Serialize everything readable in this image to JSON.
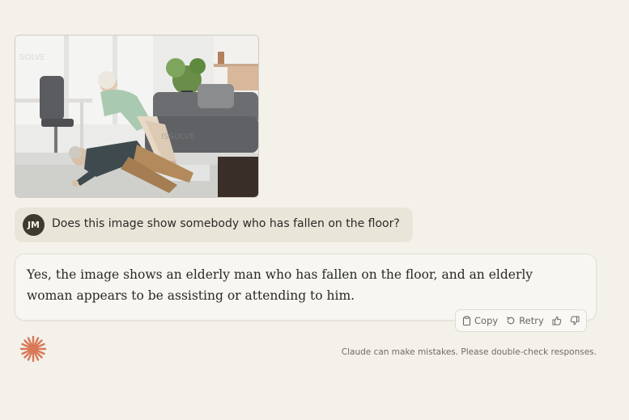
{
  "conversation": {
    "attached_image": {
      "alt": "Elderly woman helping elderly man who has fallen on the floor of a living room"
    },
    "user_message": {
      "avatar_initials": "JM",
      "text": "Does this image show somebody who has fallen on the floor?"
    },
    "assistant_message": {
      "text": "Yes, the image shows an elderly man who has fallen on the floor, and an elderly woman appears to be assisting or attending to him."
    },
    "actions": {
      "copy_label": "Copy",
      "retry_label": "Retry"
    }
  },
  "footer": {
    "disclaimer": "Claude can make mistakes. Please double-check responses."
  },
  "colors": {
    "background": "#f3f1ea",
    "user_bubble": "#e9e5d9",
    "avatar": "#3d3a2f",
    "brand_accent": "#d97757"
  },
  "icons": {
    "copy": "clipboard-icon",
    "retry": "retry-icon",
    "thumbs_up": "thumbs-up-icon",
    "thumbs_down": "thumbs-down-icon",
    "logo": "claude-sparkle-icon"
  }
}
